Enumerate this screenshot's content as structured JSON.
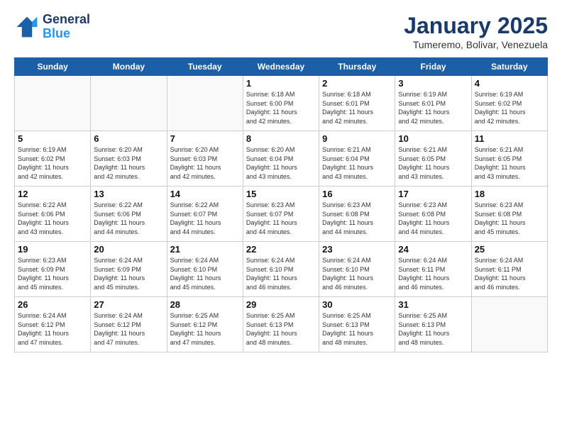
{
  "header": {
    "logo_general": "General",
    "logo_blue": "Blue",
    "month_title": "January 2025",
    "location": "Tumeremo, Bolivar, Venezuela"
  },
  "weekdays": [
    "Sunday",
    "Monday",
    "Tuesday",
    "Wednesday",
    "Thursday",
    "Friday",
    "Saturday"
  ],
  "weeks": [
    [
      {
        "day": "",
        "info": ""
      },
      {
        "day": "",
        "info": ""
      },
      {
        "day": "",
        "info": ""
      },
      {
        "day": "1",
        "info": "Sunrise: 6:18 AM\nSunset: 6:00 PM\nDaylight: 11 hours\nand 42 minutes."
      },
      {
        "day": "2",
        "info": "Sunrise: 6:18 AM\nSunset: 6:01 PM\nDaylight: 11 hours\nand 42 minutes."
      },
      {
        "day": "3",
        "info": "Sunrise: 6:19 AM\nSunset: 6:01 PM\nDaylight: 11 hours\nand 42 minutes."
      },
      {
        "day": "4",
        "info": "Sunrise: 6:19 AM\nSunset: 6:02 PM\nDaylight: 11 hours\nand 42 minutes."
      }
    ],
    [
      {
        "day": "5",
        "info": "Sunrise: 6:19 AM\nSunset: 6:02 PM\nDaylight: 11 hours\nand 42 minutes."
      },
      {
        "day": "6",
        "info": "Sunrise: 6:20 AM\nSunset: 6:03 PM\nDaylight: 11 hours\nand 42 minutes."
      },
      {
        "day": "7",
        "info": "Sunrise: 6:20 AM\nSunset: 6:03 PM\nDaylight: 11 hours\nand 42 minutes."
      },
      {
        "day": "8",
        "info": "Sunrise: 6:20 AM\nSunset: 6:04 PM\nDaylight: 11 hours\nand 43 minutes."
      },
      {
        "day": "9",
        "info": "Sunrise: 6:21 AM\nSunset: 6:04 PM\nDaylight: 11 hours\nand 43 minutes."
      },
      {
        "day": "10",
        "info": "Sunrise: 6:21 AM\nSunset: 6:05 PM\nDaylight: 11 hours\nand 43 minutes."
      },
      {
        "day": "11",
        "info": "Sunrise: 6:21 AM\nSunset: 6:05 PM\nDaylight: 11 hours\nand 43 minutes."
      }
    ],
    [
      {
        "day": "12",
        "info": "Sunrise: 6:22 AM\nSunset: 6:06 PM\nDaylight: 11 hours\nand 43 minutes."
      },
      {
        "day": "13",
        "info": "Sunrise: 6:22 AM\nSunset: 6:06 PM\nDaylight: 11 hours\nand 44 minutes."
      },
      {
        "day": "14",
        "info": "Sunrise: 6:22 AM\nSunset: 6:07 PM\nDaylight: 11 hours\nand 44 minutes."
      },
      {
        "day": "15",
        "info": "Sunrise: 6:23 AM\nSunset: 6:07 PM\nDaylight: 11 hours\nand 44 minutes."
      },
      {
        "day": "16",
        "info": "Sunrise: 6:23 AM\nSunset: 6:08 PM\nDaylight: 11 hours\nand 44 minutes."
      },
      {
        "day": "17",
        "info": "Sunrise: 6:23 AM\nSunset: 6:08 PM\nDaylight: 11 hours\nand 44 minutes."
      },
      {
        "day": "18",
        "info": "Sunrise: 6:23 AM\nSunset: 6:08 PM\nDaylight: 11 hours\nand 45 minutes."
      }
    ],
    [
      {
        "day": "19",
        "info": "Sunrise: 6:23 AM\nSunset: 6:09 PM\nDaylight: 11 hours\nand 45 minutes."
      },
      {
        "day": "20",
        "info": "Sunrise: 6:24 AM\nSunset: 6:09 PM\nDaylight: 11 hours\nand 45 minutes."
      },
      {
        "day": "21",
        "info": "Sunrise: 6:24 AM\nSunset: 6:10 PM\nDaylight: 11 hours\nand 45 minutes."
      },
      {
        "day": "22",
        "info": "Sunrise: 6:24 AM\nSunset: 6:10 PM\nDaylight: 11 hours\nand 46 minutes."
      },
      {
        "day": "23",
        "info": "Sunrise: 6:24 AM\nSunset: 6:10 PM\nDaylight: 11 hours\nand 46 minutes."
      },
      {
        "day": "24",
        "info": "Sunrise: 6:24 AM\nSunset: 6:11 PM\nDaylight: 11 hours\nand 46 minutes."
      },
      {
        "day": "25",
        "info": "Sunrise: 6:24 AM\nSunset: 6:11 PM\nDaylight: 11 hours\nand 46 minutes."
      }
    ],
    [
      {
        "day": "26",
        "info": "Sunrise: 6:24 AM\nSunset: 6:12 PM\nDaylight: 11 hours\nand 47 minutes."
      },
      {
        "day": "27",
        "info": "Sunrise: 6:24 AM\nSunset: 6:12 PM\nDaylight: 11 hours\nand 47 minutes."
      },
      {
        "day": "28",
        "info": "Sunrise: 6:25 AM\nSunset: 6:12 PM\nDaylight: 11 hours\nand 47 minutes."
      },
      {
        "day": "29",
        "info": "Sunrise: 6:25 AM\nSunset: 6:13 PM\nDaylight: 11 hours\nand 48 minutes."
      },
      {
        "day": "30",
        "info": "Sunrise: 6:25 AM\nSunset: 6:13 PM\nDaylight: 11 hours\nand 48 minutes."
      },
      {
        "day": "31",
        "info": "Sunrise: 6:25 AM\nSunset: 6:13 PM\nDaylight: 11 hours\nand 48 minutes."
      },
      {
        "day": "",
        "info": ""
      }
    ]
  ]
}
